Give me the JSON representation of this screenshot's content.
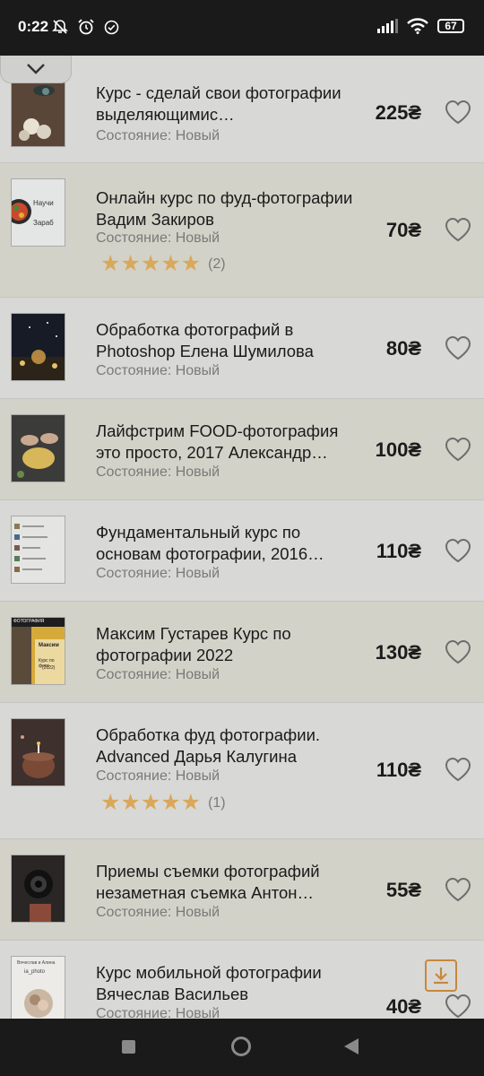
{
  "status": {
    "time": "0:22",
    "battery": "67",
    "icons": [
      "mute-bell-icon",
      "alarm-icon",
      "check-circle-icon",
      "signal-icon",
      "wifi-icon",
      "battery-icon"
    ]
  },
  "colors": {
    "star": "#d9a85a",
    "download_accent": "#c8873a",
    "row_gray": "#d8d8d6",
    "row_tan": "#d3d2c8"
  },
  "items": [
    {
      "title": "Курс - сделай свои фотографии выделяющимис…",
      "condition": "Состояние: Новый",
      "price": "225₴"
    },
    {
      "title": "Онлайн курс по фуд-фотографии Вадим Закиров",
      "condition": "Состояние: Новый",
      "price": "70₴",
      "rating": "★★★★★",
      "rating_value": 5,
      "reviews": "(2)"
    },
    {
      "title": "Обработка фотографий в Photoshop Елена Шумилова",
      "condition": "Состояние: Новый",
      "price": "80₴"
    },
    {
      "title": "Лайфстрим FOOD-фотография это просто, 2017 Александр…",
      "condition": "Состояние: Новый",
      "price": "100₴"
    },
    {
      "title": "Фундаментальный курс по основам фотографии, 2016…",
      "condition": "Состояние: Новый",
      "price": "110₴"
    },
    {
      "title": "Максим Густарев Курс по фотографии 2022",
      "condition": "Состояние: Новый",
      "price": "130₴"
    },
    {
      "title": "Обработка фуд фотографии. Advanced Дарья Калугина",
      "condition": "Состояние: Новый",
      "price": "110₴",
      "rating": "★★★★★",
      "rating_value": 5,
      "reviews": "(1)"
    },
    {
      "title": "Приемы съемки фотографий незаметная съемка Антон…",
      "condition": "Состояние: Новый",
      "price": "55₴"
    },
    {
      "title": "Курс мобильной фотографии Вячеслав Васильев",
      "condition": "Состояние: Новый",
      "price": "40₴"
    }
  ],
  "thumb_texts": {
    "t2": [
      "Научи",
      "Зараб"
    ],
    "t6": [
      "ФОТОГРАФИЯ",
      "Максим",
      "Курс по фото",
      "(2022)"
    ],
    "t9": [
      "Вячеслав и Алина",
      "ia_photo"
    ]
  }
}
